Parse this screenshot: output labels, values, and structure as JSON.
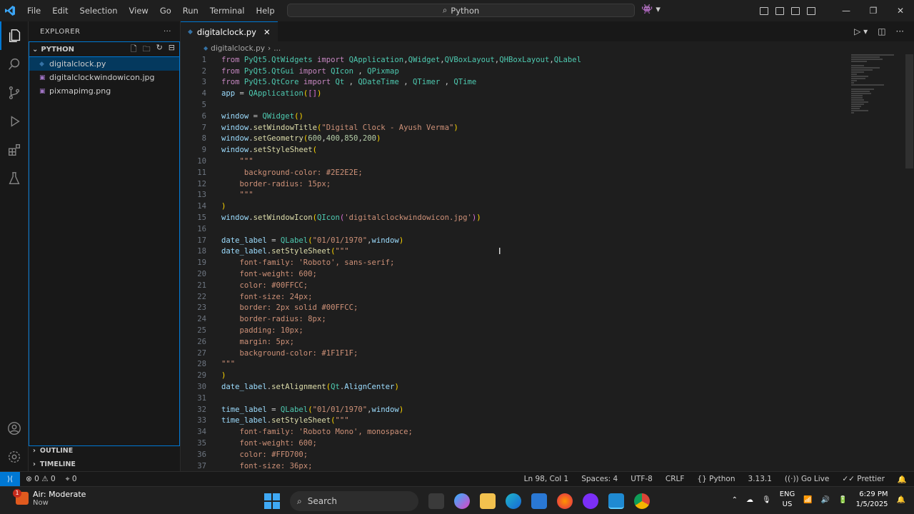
{
  "titlebar": {
    "menu": [
      "File",
      "Edit",
      "Selection",
      "View",
      "Go",
      "Run",
      "Terminal",
      "Help"
    ],
    "search": "Python"
  },
  "sidebar": {
    "title": "EXPLORER",
    "folder": "PYTHON",
    "files": [
      "digitalclock.py",
      "digitalclockwindowicon.jpg",
      "pixmapimg.png"
    ],
    "outline": "OUTLINE",
    "timeline": "TIMELINE"
  },
  "editor": {
    "tab": "digitalclock.py",
    "breadcrumb": "digitalclock.py",
    "breadcrumb_more": "..."
  },
  "status": {
    "errors": "0",
    "warnings": "0",
    "ports": "0",
    "position": "Ln 98, Col 1",
    "spaces": "Spaces: 4",
    "encoding": "UTF-8",
    "eol": "CRLF",
    "language": "Python",
    "version": "3.13.1",
    "golive": "Go Live",
    "prettier": "Prettier"
  },
  "taskbar": {
    "weather_title": "Air: Moderate",
    "weather_sub": "Now",
    "weather_badge": "1",
    "search": "Search",
    "lang1": "ENG",
    "lang2": "US",
    "time": "6:29 PM",
    "date": "1/5/2025"
  },
  "colors": {
    "accent": "#0078d4",
    "keyword": "#c586c0",
    "function": "#dcdcaa",
    "class": "#4ec9b0",
    "string": "#ce9178"
  }
}
